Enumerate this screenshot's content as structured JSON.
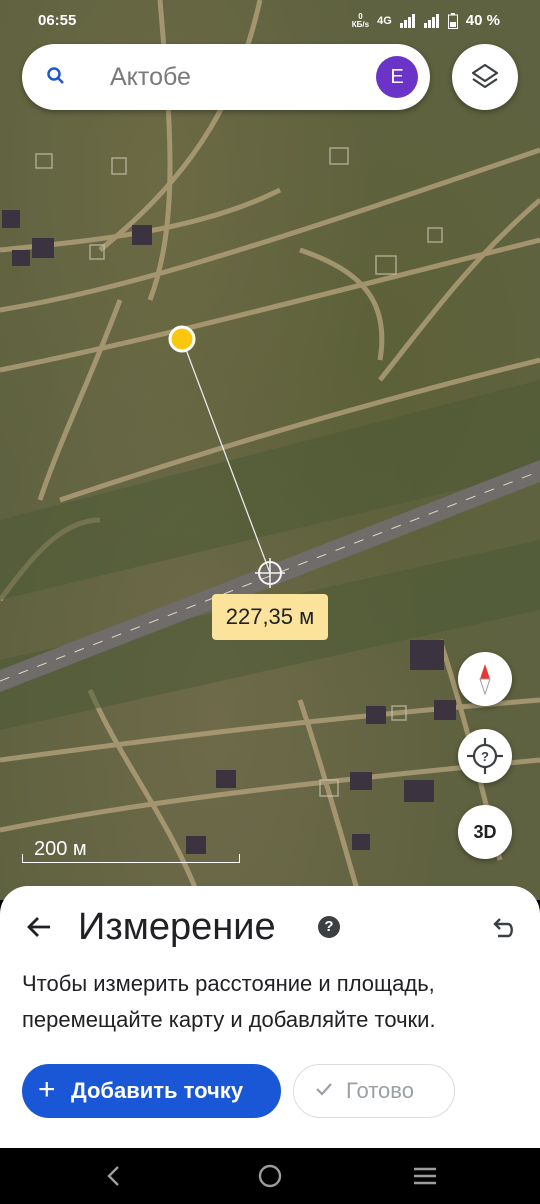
{
  "status_bar": {
    "time": "06:55",
    "net_speed_value": "0",
    "net_speed_unit": "КБ/s",
    "network": "4G",
    "battery": "40 %"
  },
  "search": {
    "placeholder": "Актобе",
    "avatar_letter": "E"
  },
  "map": {
    "distance_label": "227,35 м",
    "scale_label": "200 м",
    "btn_3d_label": "3D",
    "point_color": "#f9c80e"
  },
  "measure_panel": {
    "title": "Измерение",
    "help_glyph": "?",
    "description": "Чтобы измерить расстояние и площадь, перемещайте карту и добавляйте точки.",
    "add_point_label": "Добавить точку",
    "add_point_icon": "+",
    "done_label": "Готово"
  },
  "colors": {
    "accent": "#1a57d6",
    "avatar": "#6a34c8",
    "label_bg": "#fbe39c"
  }
}
